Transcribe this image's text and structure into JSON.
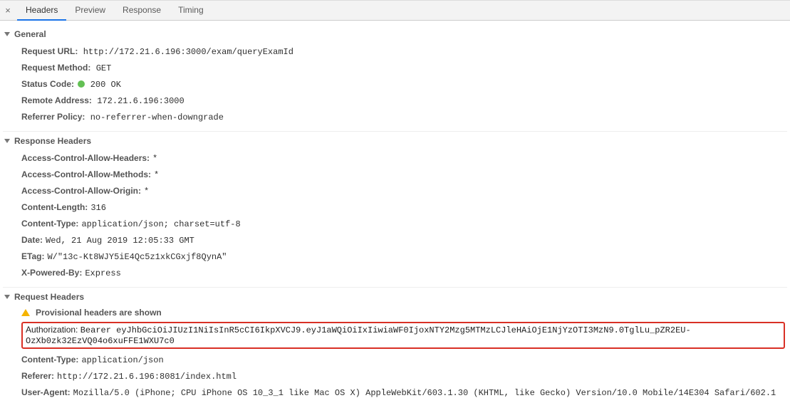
{
  "tabs": {
    "headers": "Headers",
    "preview": "Preview",
    "response": "Response",
    "timing": "Timing"
  },
  "sections": {
    "general": "General",
    "response_headers": "Response Headers",
    "request_headers": "Request Headers"
  },
  "general": {
    "request_url_label": "Request URL:",
    "request_url": "http://172.21.6.196:3000/exam/queryExamId",
    "request_method_label": "Request Method:",
    "request_method": "GET",
    "status_code_label": "Status Code:",
    "status_code": "200 OK",
    "remote_address_label": "Remote Address:",
    "remote_address": "172.21.6.196:3000",
    "referrer_policy_label": "Referrer Policy:",
    "referrer_policy": "no-referrer-when-downgrade"
  },
  "response_headers": {
    "acah_label": "Access-Control-Allow-Headers:",
    "acah": "*",
    "acam_label": "Access-Control-Allow-Methods:",
    "acam": "*",
    "acao_label": "Access-Control-Allow-Origin:",
    "acao": "*",
    "content_length_label": "Content-Length:",
    "content_length": "316",
    "content_type_label": "Content-Type:",
    "content_type": "application/json; charset=utf-8",
    "date_label": "Date:",
    "date": "Wed, 21 Aug 2019 12:05:33 GMT",
    "etag_label": "ETag:",
    "etag": "W/\"13c-Kt8WJY5iE4Qc5z1xkCGxjf8QynA\"",
    "xpb_label": "X-Powered-By:",
    "xpb": "Express"
  },
  "request_headers": {
    "provisional": "Provisional headers are shown",
    "authorization_label": "Authorization:",
    "authorization": "Bearer eyJhbGciOiJIUzI1NiIsInR5cCI6IkpXVCJ9.eyJ1aWQiOiIxIiwiaWF0IjoxNTY2Mzg5MTMzLCJleHAiOjE1NjYzOTI3MzN9.0TglLu_pZR2EU-OzXb0zk32EzVQ04o6xuFFE1WXU7c0",
    "content_type_label": "Content-Type:",
    "content_type": "application/json",
    "referer_label": "Referer:",
    "referer": "http://172.21.6.196:8081/index.html",
    "user_agent_label": "User-Agent:",
    "user_agent": "Mozilla/5.0 (iPhone; CPU iPhone OS 10_3_1 like Mac OS X) AppleWebKit/603.1.30 (KHTML, like Gecko) Version/10.0 Mobile/14E304 Safari/602.1"
  }
}
